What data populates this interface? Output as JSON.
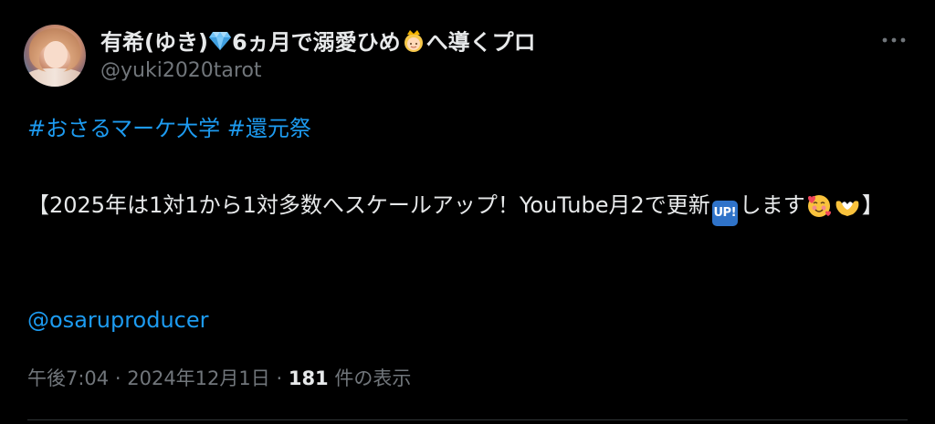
{
  "author": {
    "display_name_part1": "有希(ゆき)",
    "display_name_part2": "6ヵ月で溺愛ひめ",
    "display_name_part3": "へ導くプロ",
    "handle": "@yuki2020tarot"
  },
  "tweet": {
    "hashtag1": "#おさるマーケ大学",
    "hashtag2": "#還元祭",
    "main_text_part1": "【2025年は1対1から1対多数へスケールアップ！YouTube月2で更新",
    "up_badge": "UP!",
    "main_text_part2": "します",
    "main_text_part3": "】",
    "mention": "@osaruproducer"
  },
  "meta": {
    "time": "午後7:04",
    "separator": "·",
    "date": "2024年12月1日",
    "view_count": "181",
    "view_label": "件の表示"
  },
  "icons": {
    "avatar": "avatar",
    "diamond": "gem-icon",
    "princess": "princess-icon",
    "smiling_hearts": "smiling-face-with-hearts-icon",
    "heart_hands": "heart-hands-icon",
    "more": "more-options-icon"
  },
  "colors": {
    "background": "#000000",
    "text": "#e7e9ea",
    "secondary": "#71767b",
    "link": "#1d9bf0"
  }
}
